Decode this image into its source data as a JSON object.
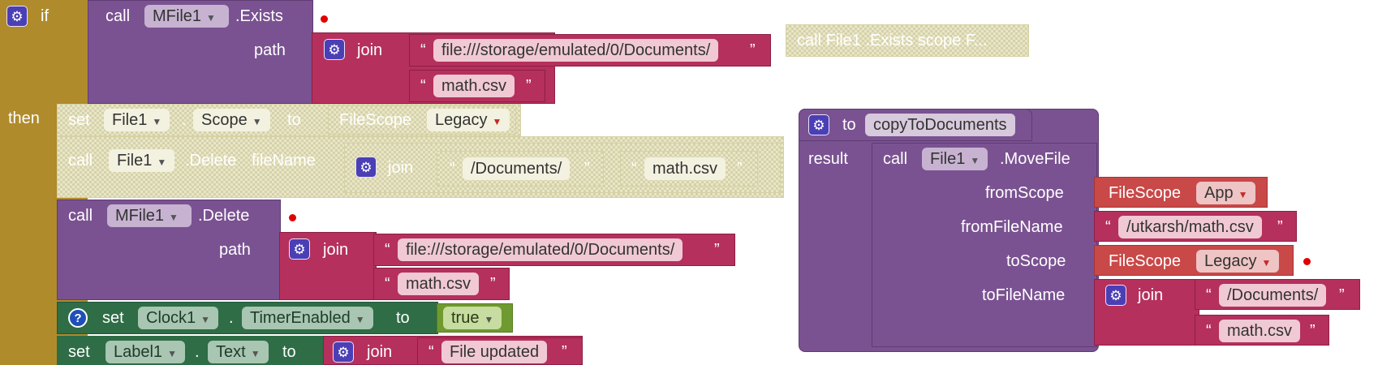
{
  "if_block": {
    "if_label": "if",
    "then_label": "then",
    "exists_call": {
      "call": "call",
      "component": "MFile1",
      "method": ".Exists",
      "path_label": "path",
      "join_label": "join",
      "string1": "file:///storage/emulated/0/Documents/",
      "string2": "math.csv"
    },
    "disabled_comment": "call  File1 .Exists scope F...",
    "set_scope": {
      "set": "set",
      "component": "File1",
      "dot": ".",
      "property": "Scope",
      "to": "to",
      "scope_label": "FileScope",
      "scope_value": "Legacy"
    },
    "delete_file": {
      "call": "call",
      "component": "File1",
      "method": ".Delete",
      "param": "fileName",
      "join_label": "join",
      "string1": "/Documents/",
      "string2": "math.csv"
    },
    "mfile_delete": {
      "call": "call",
      "component": "MFile1",
      "method": ".Delete",
      "path_label": "path",
      "join_label": "join",
      "string1": "file:///storage/emulated/0/Documents/",
      "string2": "math.csv"
    },
    "clock_set": {
      "help": "?",
      "set": "set",
      "component": "Clock1",
      "dot": ".",
      "property": "TimerEnabled",
      "to": "to",
      "value": "true"
    },
    "label_set": {
      "set": "set",
      "component": "Label1",
      "dot": ".",
      "property": "Text",
      "to": "to",
      "join_label": "join",
      "string1": "File updated"
    }
  },
  "procedure": {
    "to": "to",
    "name": "copyToDocuments",
    "result": "result",
    "call": "call",
    "component": "File1",
    "method": ".MoveFile",
    "from_scope_label": "fromScope",
    "from_scope_type": "FileScope",
    "from_scope_value": "App",
    "from_file_label": "fromFileName",
    "from_file_value": "/utkarsh/math.csv",
    "to_scope_label": "toScope",
    "to_scope_type": "FileScope",
    "to_scope_value": "Legacy",
    "to_file_label": "toFileName",
    "join_label": "join",
    "to_string1": "/Documents/",
    "to_string2": "math.csv"
  },
  "glyphs": {
    "gear": "⚙",
    "dropdown": "▼",
    "open_quote": "“",
    "close_quote": "”"
  },
  "colors": {
    "control": "#b08b2c",
    "component": "#7a5291",
    "text": "#b5305d",
    "disabled": "#e9e6c6",
    "logic": "#6f9a2f",
    "clock": "#2e6d45",
    "scope": "#c94848",
    "warning_dot": "#e00000"
  }
}
